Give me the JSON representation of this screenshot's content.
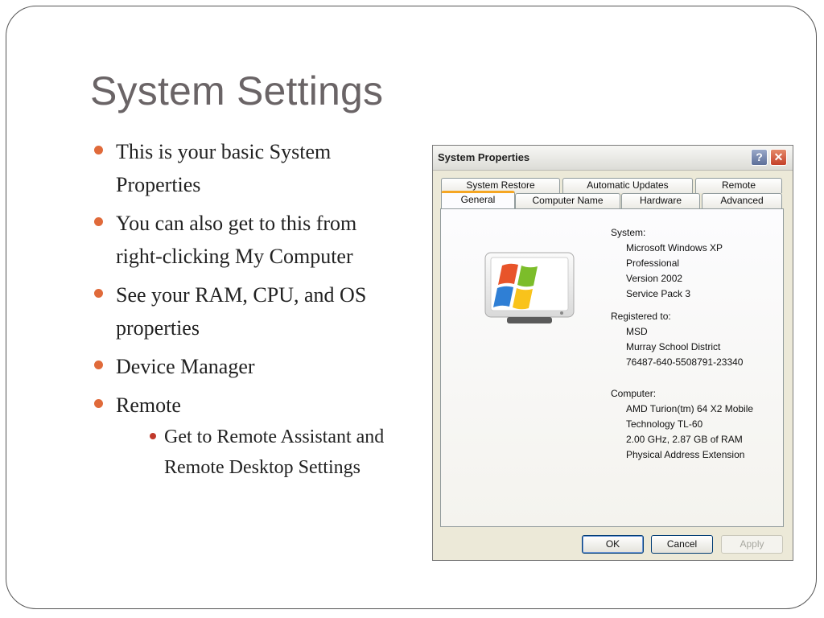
{
  "slide": {
    "title": "System Settings",
    "bullets": [
      {
        "lines": [
          "This is your basic System",
          "Properties"
        ]
      },
      {
        "lines": [
          "You can also get to this from",
          "right-clicking My Computer"
        ]
      },
      {
        "lines": [
          "See your RAM, CPU, and OS",
          "properties"
        ]
      },
      {
        "lines": [
          "Device Manager"
        ]
      },
      {
        "lines": [
          "Remote"
        ]
      }
    ],
    "sub_bullets": [
      {
        "lines": [
          "Get to Remote Assistant and",
          "Remote Desktop Settings"
        ]
      }
    ]
  },
  "dialog": {
    "title": "System Properties",
    "help_label": "?",
    "close_label": "✕",
    "tabs_back": [
      "System Restore",
      "Automatic Updates",
      "Remote"
    ],
    "tabs_front": [
      "General",
      "Computer Name",
      "Hardware",
      "Advanced"
    ],
    "active_tab": "General",
    "system_label": "System:",
    "system_values": [
      "Microsoft Windows XP",
      "Professional",
      "Version 2002",
      "Service Pack 3"
    ],
    "registered_label": "Registered to:",
    "registered_values": [
      "MSD",
      "Murray School District",
      "76487-640-5508791-23340"
    ],
    "computer_label": "Computer:",
    "computer_values": [
      "AMD Turion(tm) 64 X2 Mobile",
      "Technology TL-60",
      "2.00 GHz, 2.87 GB of RAM",
      "Physical Address Extension"
    ],
    "buttons": {
      "ok": "OK",
      "cancel": "Cancel",
      "apply": "Apply"
    },
    "colors": {
      "accent_tab": "#f5a623",
      "bullet": "#e06a3a"
    }
  }
}
